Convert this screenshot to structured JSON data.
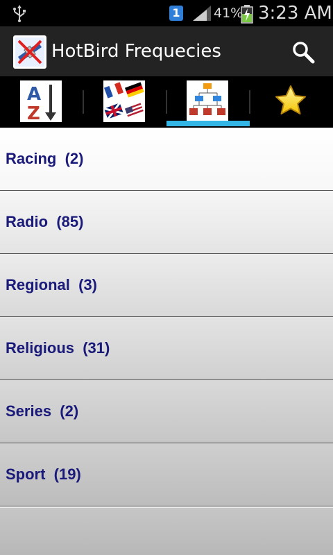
{
  "status_bar": {
    "notification_badge": "1",
    "battery_percent": "41%",
    "time": "3:23 AM",
    "icons": [
      "usb-icon",
      "notification-icon",
      "signal-icon",
      "battery-charging-icon"
    ]
  },
  "action_bar": {
    "title": "HotBird Frequecies",
    "app_icon": "satellite-app-icon",
    "search_icon": "search-icon"
  },
  "tabs": [
    {
      "name": "alphabetical-sort",
      "icon": "az-sort-icon",
      "selected": false
    },
    {
      "name": "languages",
      "icon": "flags-icon",
      "selected": false
    },
    {
      "name": "categories",
      "icon": "category-tree-icon",
      "selected": true
    },
    {
      "name": "favorites",
      "icon": "star-icon",
      "selected": false
    }
  ],
  "colors": {
    "accent": "#33b5e5",
    "item_text": "#1a1a7a",
    "action_bar": "#232323"
  },
  "list": {
    "items": [
      {
        "label": "Racing  (2)"
      },
      {
        "label": "Radio  (85)"
      },
      {
        "label": "Regional  (3)"
      },
      {
        "label": "Religious  (31)"
      },
      {
        "label": "Series  (2)"
      },
      {
        "label": "Sport  (19)"
      },
      {
        "label": ""
      }
    ]
  }
}
